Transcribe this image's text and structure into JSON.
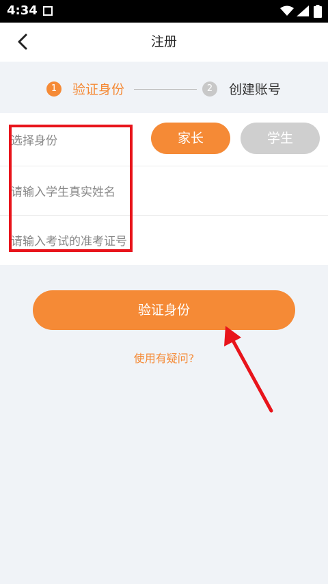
{
  "status_bar": {
    "time": "4:34"
  },
  "header": {
    "title": "注册"
  },
  "steps": [
    {
      "number": "1",
      "label": "验证身份"
    },
    {
      "number": "2",
      "label": "创建账号"
    }
  ],
  "form": {
    "identity_label": "选择身份",
    "role_options": [
      "家长",
      "学生"
    ],
    "selected_role": "家长",
    "name_placeholder": "请输入学生真实姓名",
    "exam_id_placeholder": "请输入考试的准考证号"
  },
  "submit_label": "验证身份",
  "help_link": "使用有疑问?",
  "colors": {
    "accent": "#f58a36",
    "annotation": "#e8141b",
    "inactive": "#cfcfcf"
  }
}
